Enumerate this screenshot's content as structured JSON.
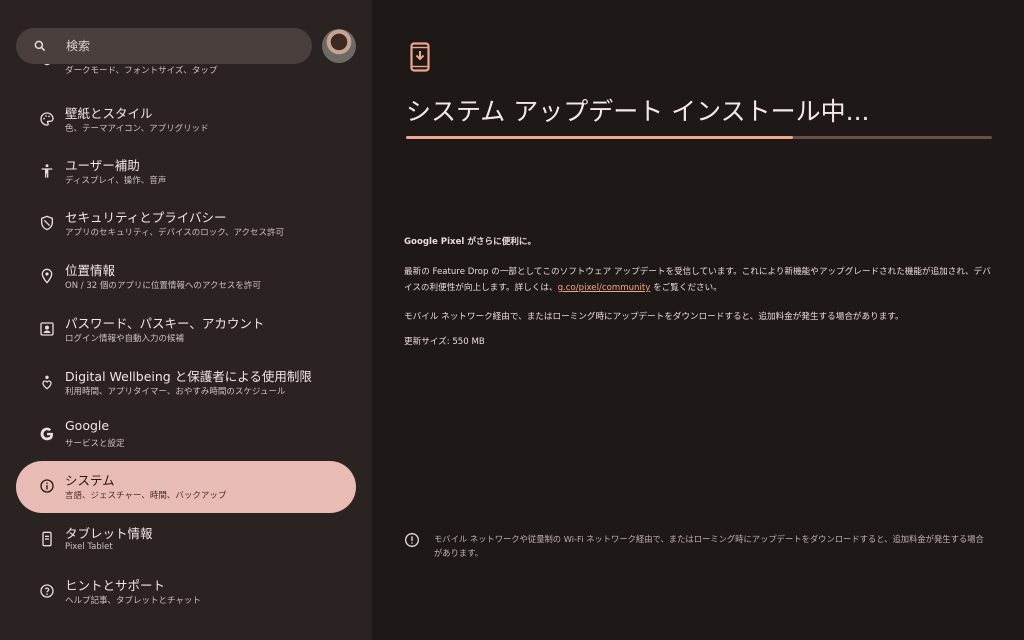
{
  "search": {
    "placeholder": "検索"
  },
  "colors": {
    "accent": "#f0a58f",
    "active_bg": "#e8bcb4",
    "sidebar_bg": "#2a2321",
    "main_bg": "#1e1817"
  },
  "sidebar": {
    "items": [
      {
        "icon": "display-settings-icon",
        "title": "",
        "subtitle": "ダークモード、フォントサイズ、タップ"
      },
      {
        "icon": "palette-icon",
        "title": "壁紙とスタイル",
        "subtitle": "色、テーマアイコン、アプリグリッド"
      },
      {
        "icon": "accessibility-icon",
        "title": "ユーザー補助",
        "subtitle": "ディスプレイ、操作、音声"
      },
      {
        "icon": "security-shield-icon",
        "title": "セキュリティとプライバシー",
        "subtitle": "アプリのセキュリティ、デバイスのロック、アクセス許可"
      },
      {
        "icon": "location-pin-icon",
        "title": "位置情報",
        "subtitle": "ON / 32 個のアプリに位置情報へのアクセスを許可"
      },
      {
        "icon": "account-box-icon",
        "title": "パスワード、パスキー、アカウント",
        "subtitle": "ログイン情報や自動入力の候補"
      },
      {
        "icon": "wellbeing-icon",
        "title": "Digital Wellbeing と保護者による使用制限",
        "subtitle": "利用時間、アプリタイマー、おやすみ時間のスケジュール"
      },
      {
        "icon": "google-g-icon",
        "title": "Google",
        "subtitle": "サービスと設定"
      },
      {
        "icon": "info-icon",
        "title": "システム",
        "subtitle": "言語、ジェスチャー、時間、バックアップ",
        "active": true
      },
      {
        "icon": "tablet-icon",
        "title": "タブレット情報",
        "subtitle": "Pixel Tablet"
      },
      {
        "icon": "help-icon",
        "title": "ヒントとサポート",
        "subtitle": "ヘルプ記事、タブレットとチャット"
      }
    ]
  },
  "main": {
    "icon": "system-update-icon",
    "title": "システム アップデート インストール中...",
    "progress": 0.66,
    "headline": "Google Pixel がさらに便利に。",
    "paragraph_before_link": "最新の Feature Drop の一部としてこのソフトウェア アップデートを受信しています。これにより新機能やアップグレードされた機能が追加され、デバイスの利便性が向上します。詳しくは、",
    "link_text": "g.co/pixel/community",
    "paragraph_after_link": " をご覧ください。",
    "mobile_note": "モバイル ネットワーク経由で、またはローミング時にアップデートをダウンロードすると、追加料金が発生する場合があります。",
    "size_label": "更新サイズ: 550 MB",
    "footer_note": "モバイル ネットワークや従量制の Wi-Fi ネットワーク経由で、またはローミング時にアップデートをダウンロードすると、追加料金が発生する場合があります。"
  }
}
